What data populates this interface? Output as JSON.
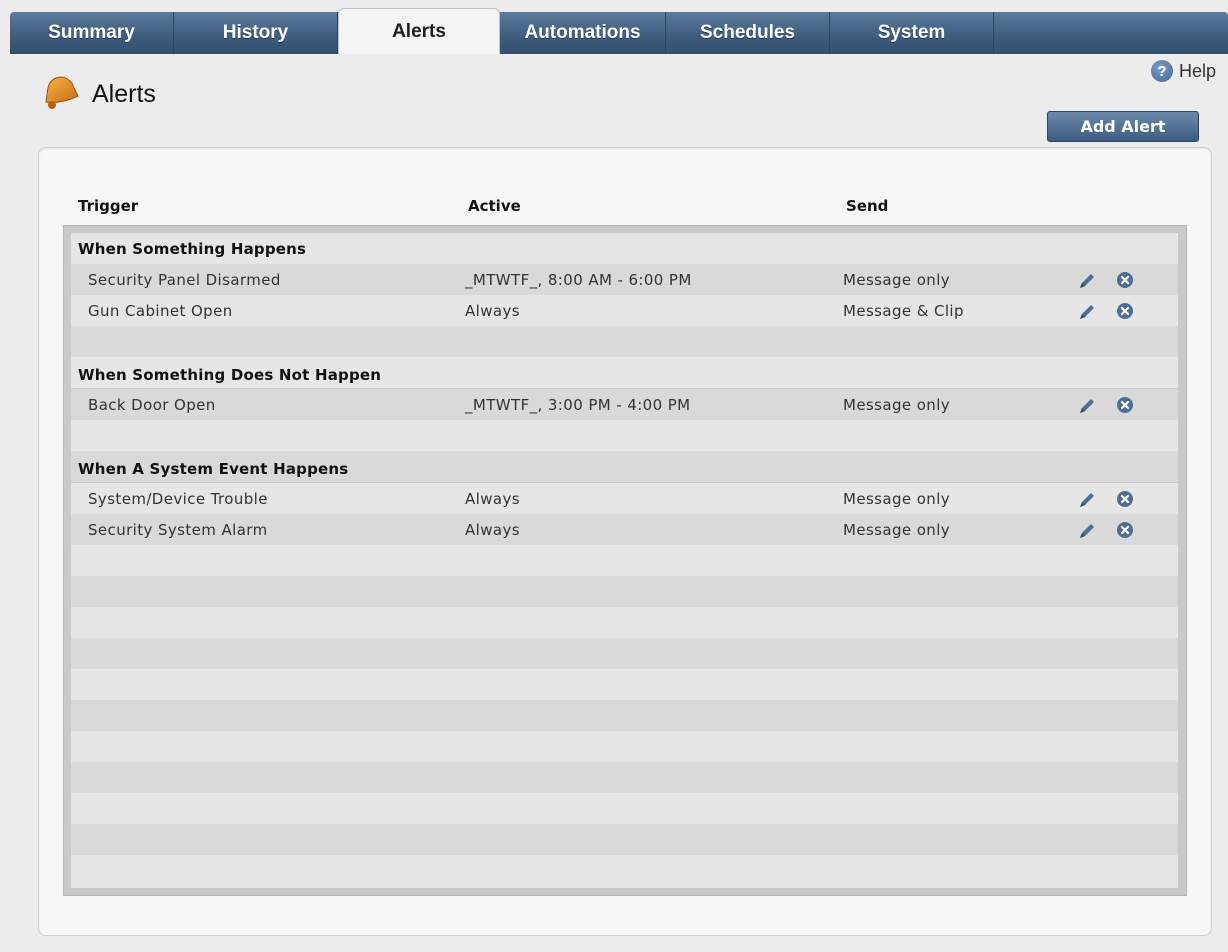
{
  "tabs": [
    {
      "label": "Summary"
    },
    {
      "label": "History"
    },
    {
      "label": "Alerts"
    },
    {
      "label": "Automations"
    },
    {
      "label": "Schedules"
    },
    {
      "label": "System"
    }
  ],
  "active_tab": "Alerts",
  "header": {
    "title": "Alerts",
    "help_label": "Help",
    "add_button_label": "Add Alert",
    "icons": {
      "page": "bell-icon",
      "help": "help-icon"
    }
  },
  "table": {
    "columns": {
      "trigger": "Trigger",
      "active": "Active",
      "send": "Send"
    },
    "groups": [
      {
        "label": "When Something Happens",
        "items": [
          {
            "trigger": "Security Panel Disarmed",
            "active": "_MTWTF_, 8:00 AM - 6:00 PM",
            "send": "Message only"
          },
          {
            "trigger": "Gun Cabinet Open",
            "active": "Always",
            "send": "Message & Clip"
          }
        ]
      },
      {
        "label": "When Something Does Not Happen",
        "items": [
          {
            "trigger": "Back Door Open",
            "active": "_MTWTF_, 3:00 PM - 4:00 PM",
            "send": "Message only"
          }
        ]
      },
      {
        "label": "When A System Event Happens",
        "items": [
          {
            "trigger": "System/Device Trouble",
            "active": "Always",
            "send": "Message only"
          },
          {
            "trigger": "Security System Alarm",
            "active": "Always",
            "send": "Message only"
          }
        ]
      }
    ],
    "row_actions": {
      "edit": "pencil-icon",
      "delete": "delete-circle-icon"
    }
  },
  "colors": {
    "tab_bar": "#3e5b7d",
    "button": "#4d6b8f",
    "bell": "#e08a1e",
    "row_light": "#e6e6e6",
    "row_dark": "#d9d9d9"
  }
}
